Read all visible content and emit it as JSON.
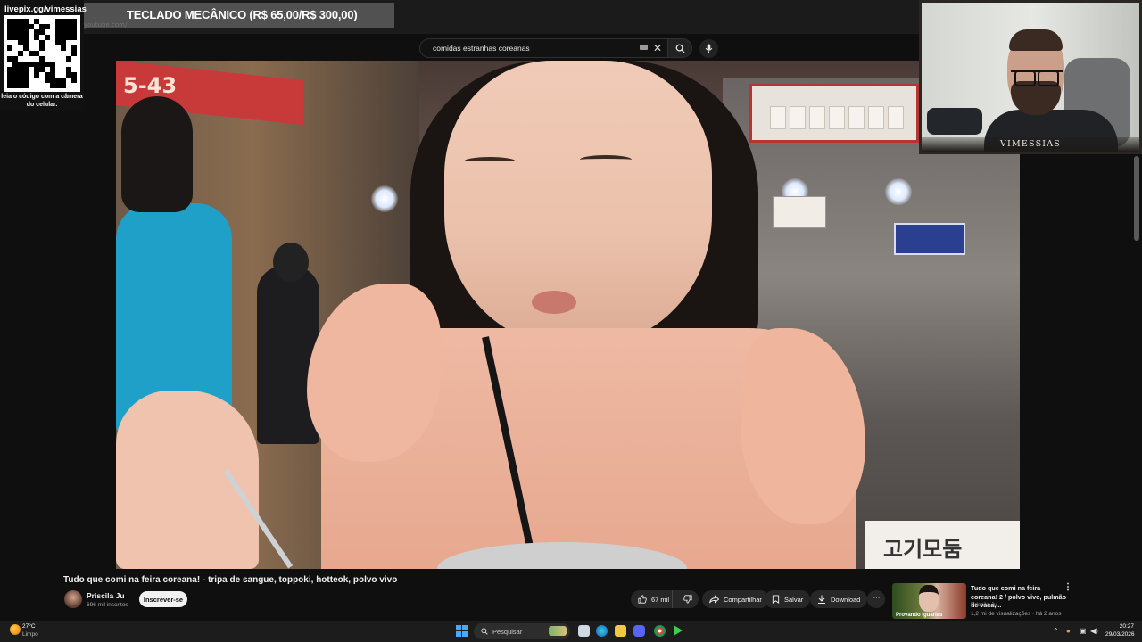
{
  "overlay": {
    "qr_url": "livepix.gg/vimessias",
    "qr_caption": "leia o código com a câmera do celular.",
    "promo_text": "TECLADO MECÂNICO (R$ 65,00/R$ 300,00)",
    "webcam_label": "VIMESSIAS"
  },
  "browser": {
    "url_text": "youtube.com/"
  },
  "search": {
    "query": "comidas estranhas coreanas",
    "clear_icon": "close-icon",
    "search_icon": "search-icon",
    "mic_icon": "mic-icon"
  },
  "video": {
    "scene_sign": "5-43",
    "bottom_sign": "고기모둠",
    "title": "Tudo que comi na feira coreana! - tripa de sangue, toppoki, hotteok, polvo vivo",
    "channel": "Priscila Ju",
    "subscribers": "696 mil inscritos",
    "subscribe_label": "Inscrever-se",
    "likes": "67 mil",
    "share_label": "Compartilhar",
    "save_label": "Salvar",
    "download_label": "Download",
    "more_label": "···"
  },
  "suggested": {
    "thumb_text": "Provando iguarias",
    "title": "Tudo que comi na feira coreana! 2 / polvo vivo, pulmão de vaca,...",
    "channel": "Priscila Ju",
    "meta": "1,2 mi de visualizações · há 2 anos",
    "menu": "⋮"
  },
  "taskbar": {
    "weather_temp": "27°C",
    "weather_desc": "Limpo",
    "search_label": "Pesquisar",
    "time": "20:27",
    "date": "29/03/2026"
  },
  "colors": {
    "youtube_bg": "#0f0f0f",
    "pill_bg": "#272727",
    "promo_bg": "#6e6e6e",
    "windows_accent": "#4aa8ff"
  }
}
